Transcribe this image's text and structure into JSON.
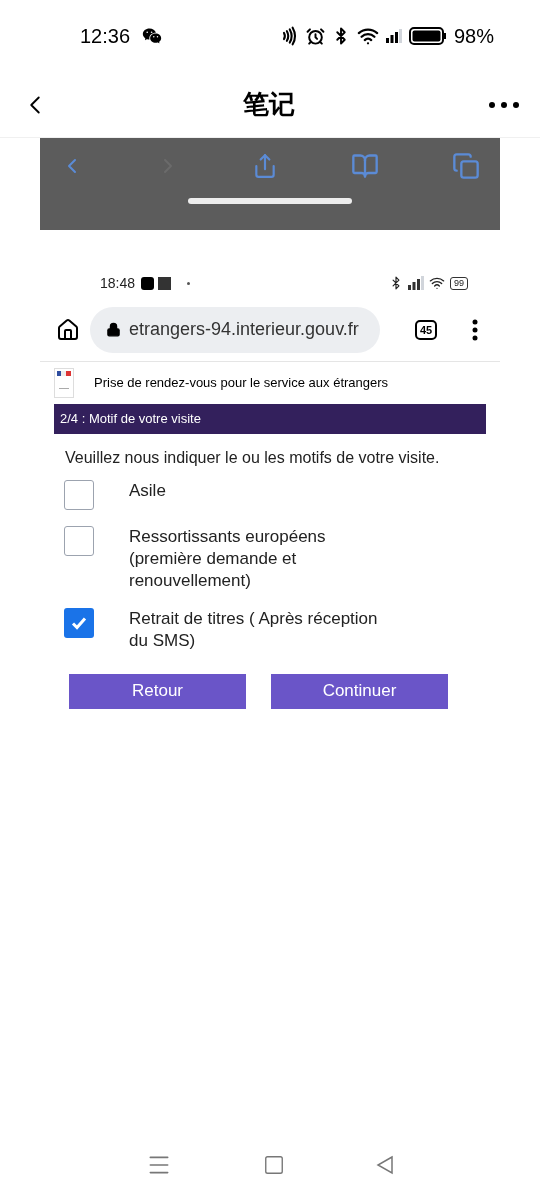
{
  "status_bar": {
    "time": "12:36",
    "battery": "98%"
  },
  "header": {
    "title": "笔记"
  },
  "note_image": {
    "inner_status_bar": {
      "time": "18:48",
      "battery": "99"
    },
    "browser": {
      "url": "etrangers-94.interieur.gouv.fr",
      "tab_count": "45"
    },
    "page": {
      "site_title": "Prise de rendez-vous pour le service aux étrangers",
      "step_banner": "2/4 : Motif de votre visite",
      "prompt": "Veuillez nous indiquer le ou les motifs de votre visite.",
      "options": [
        {
          "label": "Asile",
          "checked": false
        },
        {
          "label": "Ressortissants européens (première demande et renouvellement)",
          "checked": false
        },
        {
          "label": "Retrait de titres ( Après réception du SMS)",
          "checked": true
        }
      ],
      "buttons": [
        {
          "label": "Retour"
        },
        {
          "label": "Continuer"
        }
      ]
    }
  }
}
